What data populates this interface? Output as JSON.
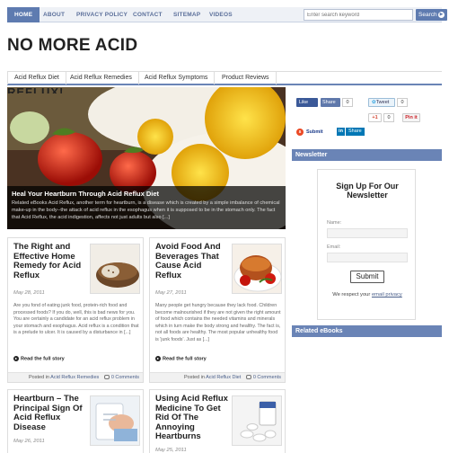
{
  "top_nav": {
    "items": [
      "HOME",
      "ABOUT",
      "PRIVACY POLICY",
      "CONTACT",
      "SITEMAP",
      "VIDEOS"
    ],
    "search_placeholder": "Enter search keyword",
    "search_button": "Search"
  },
  "site_title": "NO MORE ACID",
  "category_nav": [
    "Acid Reflux Diet",
    "Acid Reflux Remedies",
    "Acid Reflux Symptoms",
    "Product Reviews"
  ],
  "slider": {
    "peek_text": "REFLUX!",
    "title": "Heal Your Heartburn Through Acid Reflux Diet",
    "excerpt": "Related eBooks Acid Reflux, another term for heartburn, is a disease which is created by a simple imbalance of chemical make-up in the body--the attack of acid reflux in the esophagus when it is supposed to be in the stomach only. The fact that Acid Reflux, the acid indigestion, affects not just adults but also [...]"
  },
  "posts": [
    {
      "title": "The Right and Effective Home Remedy for Acid Reflux",
      "date": "May 28, 2011",
      "excerpt": "Are you fond of eating junk food, protein-rich food and processed foods? If you do, well, this is bad news for you. You are certainly a candidate for an acid reflux problem in your stomach and esophagus. Acid reflux is a condition that is a prelude to ulcer. It is caused by a disturbance in [...]",
      "read_more": "Read the full story",
      "posted_in": "Posted in",
      "category": "Acid Reflux Remedies",
      "comments": "0 Comments"
    },
    {
      "title": "Avoid Food And Beverages That Cause Acid Reflux",
      "date": "May 27, 2011",
      "excerpt": "Many people get hungry because they lack food. Children become malnourished if they are not given the right amount of food which contains the needed vitamins and minerals which in turn make the body strong and healthy. The fact is, not all foods are healthy. The most popular unhealthy food is 'junk foods'. Just as [...]",
      "read_more": "Read the full story",
      "posted_in": "Posted in",
      "category": "Acid Reflux Diet",
      "comments": "0 Comments"
    },
    {
      "title": "Heartburn – The Principal Sign Of Acid Reflux Disease",
      "date": "May 26, 2011"
    },
    {
      "title": "Using Acid Reflux Medicine To Get Rid Of The Annoying Heartburns",
      "date": "May 25, 2011"
    }
  ],
  "social": {
    "like": "Like",
    "share": "Share",
    "like_count": "0",
    "tweet": "Tweet",
    "tweet_count": "0",
    "gplus": "+1",
    "gplus_count": "0",
    "pin": "Pin it",
    "submit": "Submit",
    "linkedin_share": "Share"
  },
  "sidebar": {
    "newsletter_heading": "Newsletter",
    "newsletter_title": "Sign Up For Our Newsletter",
    "name_label": "Name:",
    "email_label": "Email:",
    "submit_button": "Submit",
    "privacy_prefix": "We respect your",
    "privacy_link": "email privacy",
    "related_heading": "Related eBooks"
  },
  "colors": {
    "accent": "#6a84b6",
    "nav_active": "#5e7bb0",
    "facebook": "#3b5998",
    "linkedin": "#0077b5",
    "pinterest": "#cb2027"
  }
}
